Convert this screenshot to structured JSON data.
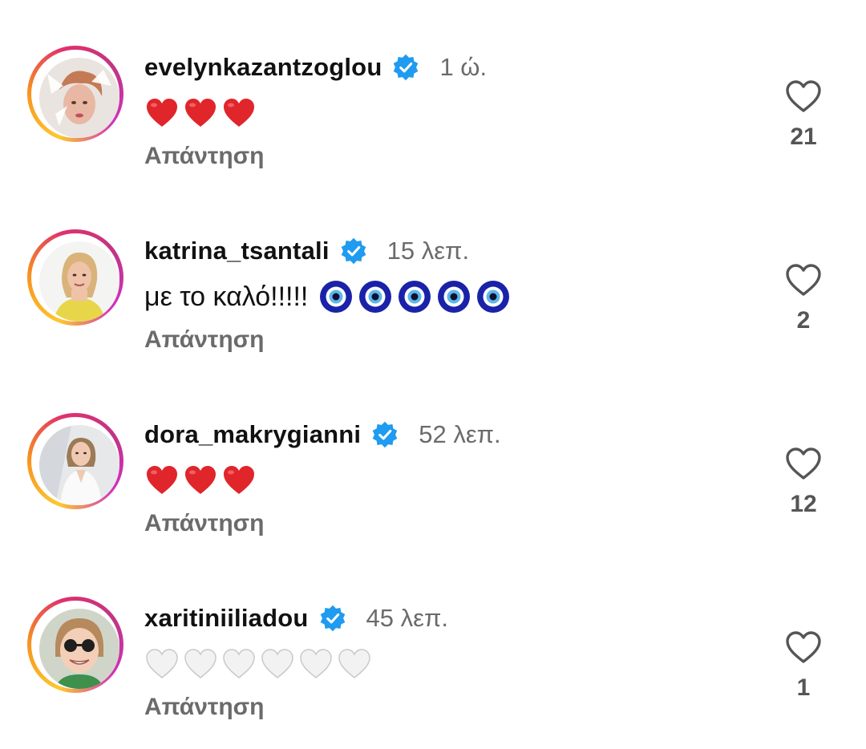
{
  "colors": {
    "verified": "#1f9bf0",
    "red_heart": "#e0252b",
    "white_heart": "#f2f2f2",
    "nazar_blue": "#1a22a8",
    "secondary_text": "#6b6b6b"
  },
  "icons": {
    "verified": "verified-badge-icon",
    "like": "heart-outline-icon"
  },
  "comments": [
    {
      "username": "evelynkazantzoglou",
      "verified": true,
      "time": "1 ώ.",
      "text": "",
      "emojis": [
        "red-heart",
        "red-heart",
        "red-heart"
      ],
      "reply_label": "Απάντηση",
      "likes": "21"
    },
    {
      "username": "katrina_tsantali",
      "verified": true,
      "time": "15 λεπ.",
      "text": "με το καλό!!!!!",
      "emojis": [
        "nazar-amulet",
        "nazar-amulet",
        "nazar-amulet",
        "nazar-amulet",
        "nazar-amulet"
      ],
      "reply_label": "Απάντηση",
      "likes": "2"
    },
    {
      "username": "dora_makrygianni",
      "verified": true,
      "time": "52 λεπ.",
      "text": "",
      "emojis": [
        "red-heart",
        "red-heart",
        "red-heart"
      ],
      "reply_label": "Απάντηση",
      "likes": "12"
    },
    {
      "username": "xaritiniiliadou",
      "verified": true,
      "time": "45 λεπ.",
      "text": "",
      "emojis": [
        "white-heart",
        "white-heart",
        "white-heart",
        "white-heart",
        "white-heart",
        "white-heart"
      ],
      "reply_label": "Απάντηση",
      "likes": "1"
    }
  ]
}
